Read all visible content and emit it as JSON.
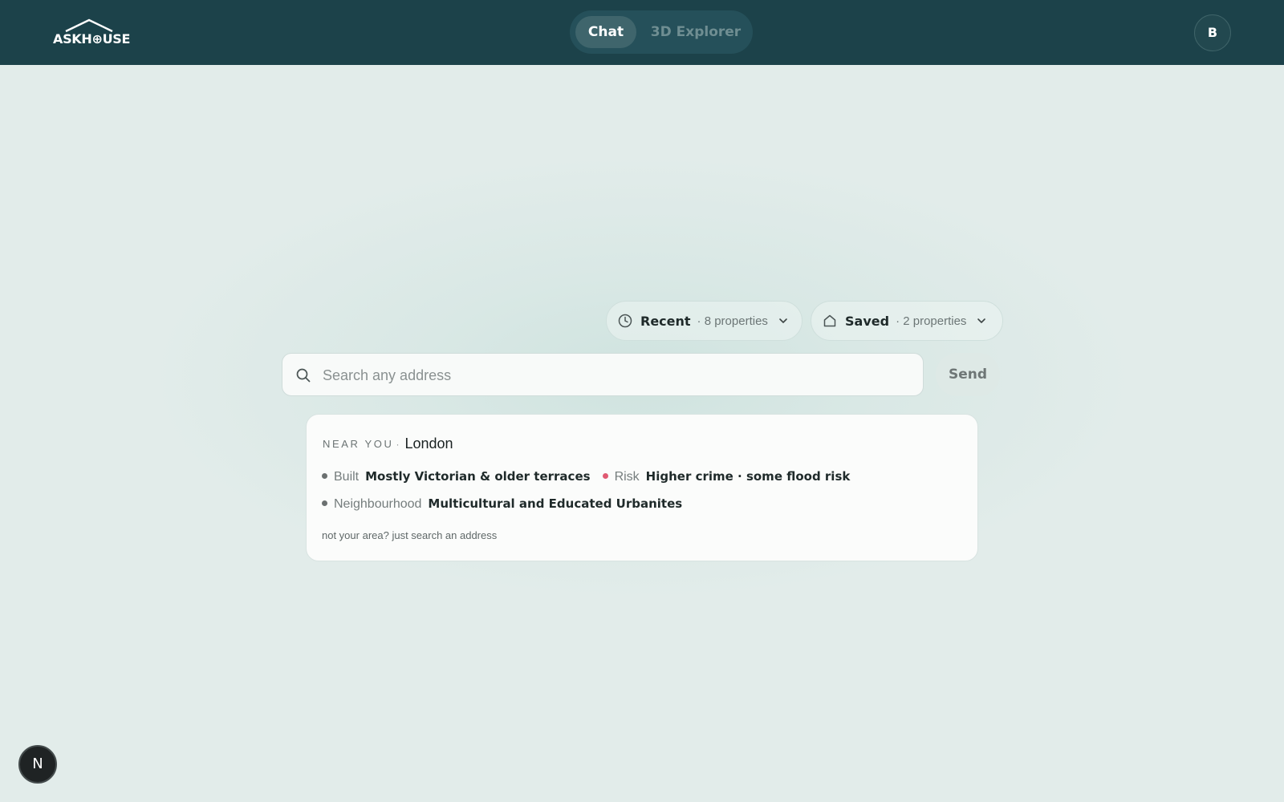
{
  "header": {
    "logo_text": "ASKH⊕USE",
    "tabs": [
      {
        "label": "Chat",
        "active": true
      },
      {
        "label": "3D Explorer",
        "active": false
      }
    ],
    "avatar_initial": "B"
  },
  "lists": {
    "recent": {
      "label": "Recent",
      "count": "· 8 properties",
      "icon": "clock-icon"
    },
    "saved": {
      "label": "Saved",
      "count": "· 2 properties",
      "icon": "house-icon"
    }
  },
  "search": {
    "placeholder": "Search any address",
    "value": "",
    "send_label": "Send"
  },
  "near_you": {
    "heading": "NEAR YOU",
    "separator": "·",
    "city": "London",
    "built_label": "Built",
    "built_value": "Mostly Victorian & older terraces",
    "risk_label": "Risk",
    "risk_value": "Higher crime · some flood risk",
    "neighbourhood_label": "Neighbourhood",
    "neighbourhood_value": "Multicultural and Educated Urbanites",
    "note": "not your area? just search an address"
  },
  "dev_badge": {
    "label": "N"
  },
  "colors": {
    "header_bg": "#1c424a",
    "risk_dot": "#e05a72",
    "page_bg": "#e0ebe9"
  }
}
